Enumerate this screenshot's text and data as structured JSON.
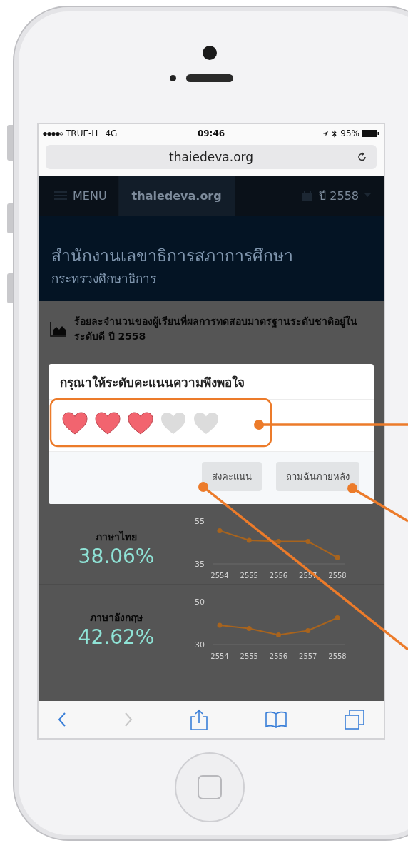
{
  "status_bar": {
    "carrier": "TRUE-H",
    "network": "4G",
    "time": "09:46",
    "battery": "95%"
  },
  "address_bar": {
    "url": "thaiedeva.org"
  },
  "nav": {
    "menu": "MENU",
    "site": "thaiedeva.org",
    "year": "ปี 2558"
  },
  "header": {
    "title": "สำนักงานเลขาธิการสภาการศึกษา",
    "subtitle": "กระทรวงศึกษาธิการ"
  },
  "section": {
    "title": "ร้อยละจำนวนของผู้เรียนที่ผลการทดสอบมาตรฐานระดับชาติอยู่ในระดับดี ปี 2558"
  },
  "dialog": {
    "title": "กรุณาให้ระดับคะแนนความพึงพอใจ",
    "stars": 3,
    "buttons": [
      {
        "label": "ส่งคะแนน"
      },
      {
        "label": "ถามฉันภายหลัง"
      }
    ]
  },
  "subjects": [
    {
      "name": "ภาษาไทย",
      "value": "38.06%",
      "chart_data": {
        "type": "line",
        "categories": [
          "2554",
          "2555",
          "2556",
          "2557",
          "2558"
        ],
        "yticks": [
          35,
          55
        ],
        "ylim": [
          35,
          55
        ],
        "series": [
          {
            "color": "#a8641e",
            "marker": "circle",
            "values": [
              50.5,
              46,
              45.5,
              45.5,
              38
            ]
          }
        ]
      }
    },
    {
      "name": "ภาษาอังกฤษ",
      "value": "42.62%",
      "chart_data": {
        "type": "line",
        "categories": [
          "2554",
          "2555",
          "2556",
          "2557",
          "2558"
        ],
        "yticks": [
          30,
          50
        ],
        "ylim": [
          30,
          50
        ],
        "series": [
          {
            "color": "#a8641e",
            "marker": "circle",
            "values": [
              39,
              37.5,
              34.5,
              36.5,
              42.5
            ]
          }
        ]
      }
    }
  ]
}
